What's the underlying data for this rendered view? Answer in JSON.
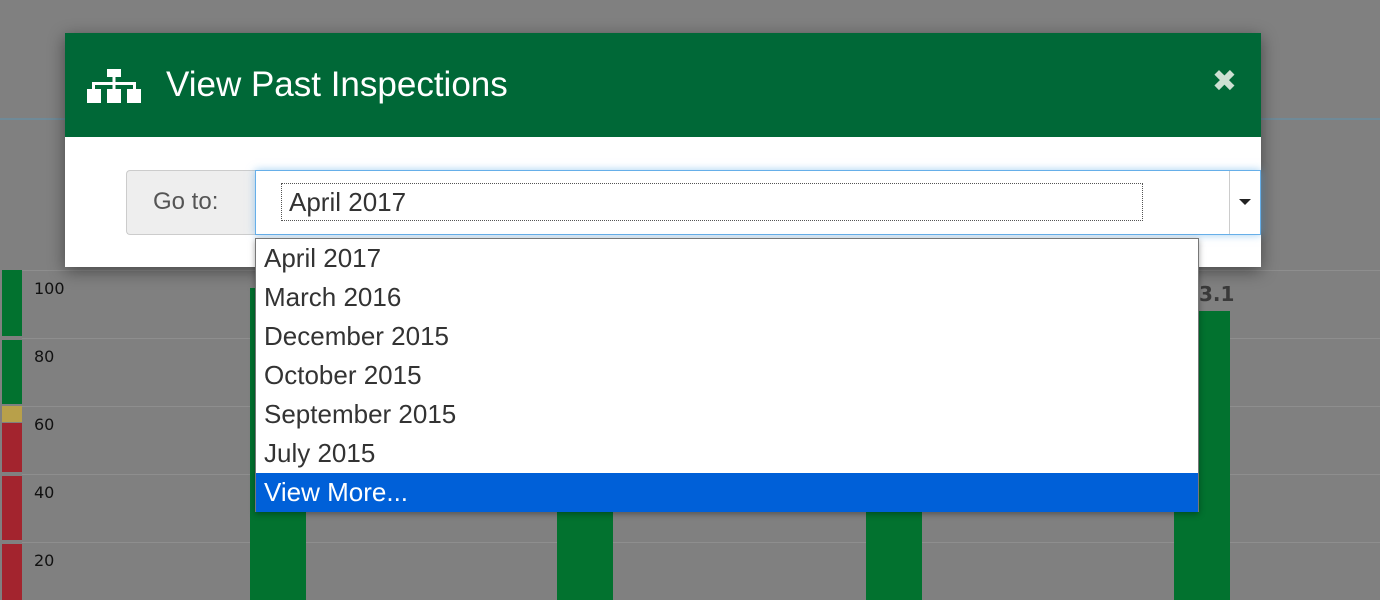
{
  "modal": {
    "title": "View Past Inspections",
    "icon": "sitemap-icon",
    "close_icon": "close-icon",
    "goto_label": "Go to:",
    "selected_value": "April 2017",
    "options": [
      "April 2017",
      "March 2016",
      "December 2015",
      "October 2015",
      "September 2015",
      "July 2015",
      "View More..."
    ],
    "highlighted_option": "View More..."
  },
  "background": {
    "y_ticks": [
      "100",
      "80",
      "60",
      "40",
      "20"
    ],
    "bar_label_partial": "3.1",
    "colors": {
      "green": "#02722f",
      "yellow": "#b8a04a",
      "red": "#a3242e"
    }
  },
  "colors": {
    "header_green": "#006837",
    "focus_blue": "#66afe9",
    "highlight_blue": "#0060d8"
  }
}
